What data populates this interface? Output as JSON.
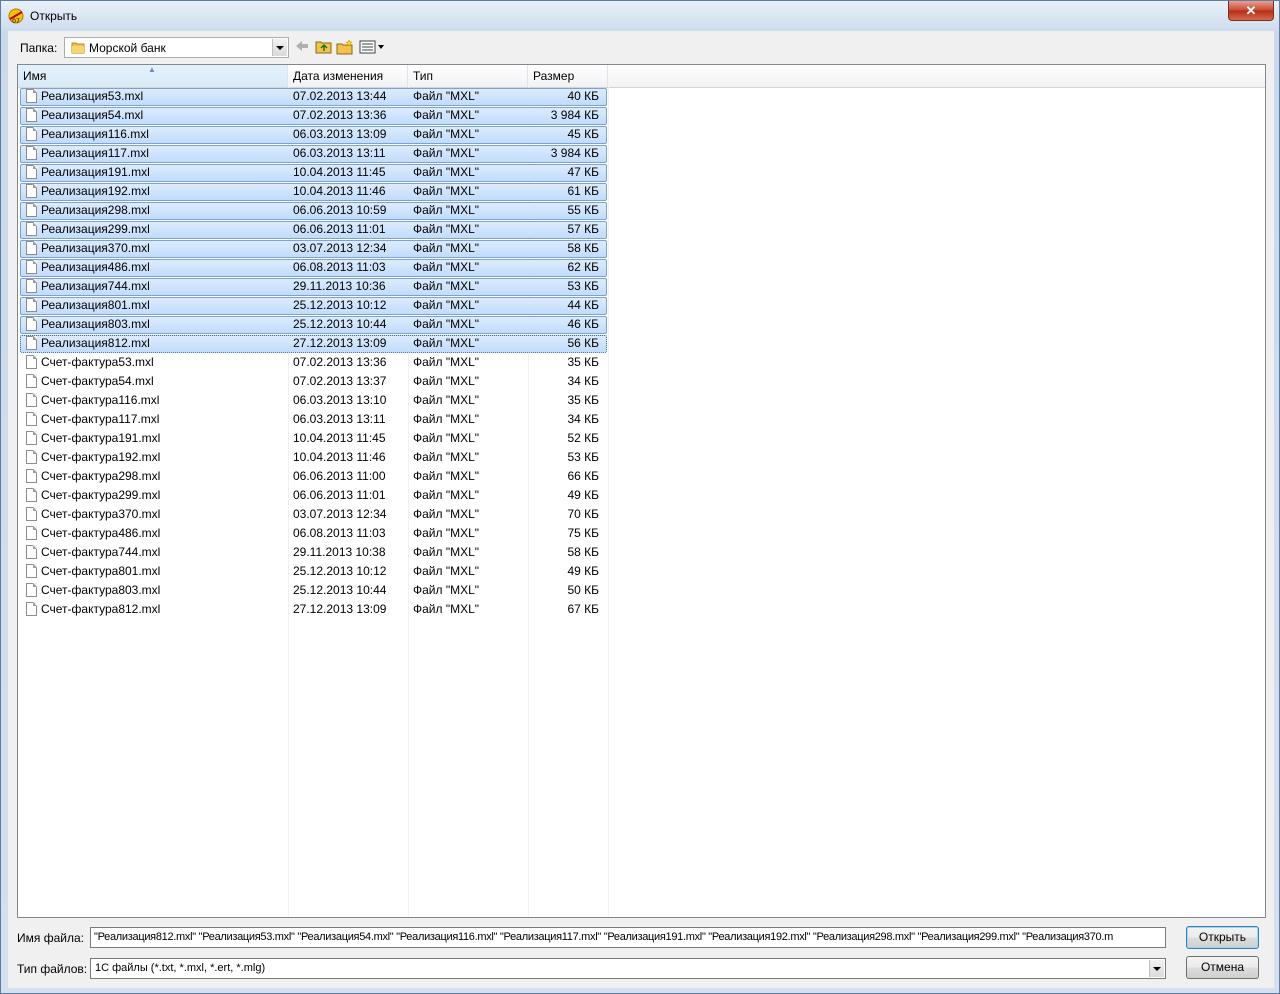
{
  "window": {
    "title": "Открыть",
    "close_label": "✕"
  },
  "toolbar": {
    "folder_label": "Папка:",
    "folder_value": "Морской банк",
    "back_icon": "back-arrow-icon",
    "up_icon": "up-folder-icon",
    "newfolder_icon": "new-folder-icon",
    "view_icon": "view-menu-icon"
  },
  "columns": {
    "name": "Имя",
    "date": "Дата изменения",
    "type": "Тип",
    "size": "Размер"
  },
  "files": [
    {
      "name": "Реализация53.mxl",
      "date": "07.02.2013 13:44",
      "type": "Файл \"MXL\"",
      "size": "40 КБ",
      "selected": true
    },
    {
      "name": "Реализация54.mxl",
      "date": "07.02.2013 13:36",
      "type": "Файл \"MXL\"",
      "size": "3 984 КБ",
      "selected": true
    },
    {
      "name": "Реализация116.mxl",
      "date": "06.03.2013 13:09",
      "type": "Файл \"MXL\"",
      "size": "45 КБ",
      "selected": true
    },
    {
      "name": "Реализация117.mxl",
      "date": "06.03.2013 13:11",
      "type": "Файл \"MXL\"",
      "size": "3 984 КБ",
      "selected": true
    },
    {
      "name": "Реализация191.mxl",
      "date": "10.04.2013 11:45",
      "type": "Файл \"MXL\"",
      "size": "47 КБ",
      "selected": true
    },
    {
      "name": "Реализация192.mxl",
      "date": "10.04.2013 11:46",
      "type": "Файл \"MXL\"",
      "size": "61 КБ",
      "selected": true
    },
    {
      "name": "Реализация298.mxl",
      "date": "06.06.2013 10:59",
      "type": "Файл \"MXL\"",
      "size": "55 КБ",
      "selected": true
    },
    {
      "name": "Реализация299.mxl",
      "date": "06.06.2013 11:01",
      "type": "Файл \"MXL\"",
      "size": "57 КБ",
      "selected": true
    },
    {
      "name": "Реализация370.mxl",
      "date": "03.07.2013 12:34",
      "type": "Файл \"MXL\"",
      "size": "58 КБ",
      "selected": true
    },
    {
      "name": "Реализация486.mxl",
      "date": "06.08.2013 11:03",
      "type": "Файл \"MXL\"",
      "size": "62 КБ",
      "selected": true
    },
    {
      "name": "Реализация744.mxl",
      "date": "29.11.2013 10:36",
      "type": "Файл \"MXL\"",
      "size": "53 КБ",
      "selected": true
    },
    {
      "name": "Реализация801.mxl",
      "date": "25.12.2013 10:12",
      "type": "Файл \"MXL\"",
      "size": "44 КБ",
      "selected": true
    },
    {
      "name": "Реализация803.mxl",
      "date": "25.12.2013 10:44",
      "type": "Файл \"MXL\"",
      "size": "46 КБ",
      "selected": true
    },
    {
      "name": "Реализация812.mxl",
      "date": "27.12.2013 13:09",
      "type": "Файл \"MXL\"",
      "size": "56 КБ",
      "selected": true,
      "focused": true
    },
    {
      "name": "Счет-фактура53.mxl",
      "date": "07.02.2013 13:36",
      "type": "Файл \"MXL\"",
      "size": "35 КБ",
      "selected": false
    },
    {
      "name": "Счет-фактура54.mxl",
      "date": "07.02.2013 13:37",
      "type": "Файл \"MXL\"",
      "size": "34 КБ",
      "selected": false
    },
    {
      "name": "Счет-фактура116.mxl",
      "date": "06.03.2013 13:10",
      "type": "Файл \"MXL\"",
      "size": "35 КБ",
      "selected": false
    },
    {
      "name": "Счет-фактура117.mxl",
      "date": "06.03.2013 13:11",
      "type": "Файл \"MXL\"",
      "size": "34 КБ",
      "selected": false
    },
    {
      "name": "Счет-фактура191.mxl",
      "date": "10.04.2013 11:45",
      "type": "Файл \"MXL\"",
      "size": "52 КБ",
      "selected": false
    },
    {
      "name": "Счет-фактура192.mxl",
      "date": "10.04.2013 11:46",
      "type": "Файл \"MXL\"",
      "size": "53 КБ",
      "selected": false
    },
    {
      "name": "Счет-фактура298.mxl",
      "date": "06.06.2013 11:00",
      "type": "Файл \"MXL\"",
      "size": "66 КБ",
      "selected": false
    },
    {
      "name": "Счет-фактура299.mxl",
      "date": "06.06.2013 11:01",
      "type": "Файл \"MXL\"",
      "size": "49 КБ",
      "selected": false
    },
    {
      "name": "Счет-фактура370.mxl",
      "date": "03.07.2013 12:34",
      "type": "Файл \"MXL\"",
      "size": "70 КБ",
      "selected": false
    },
    {
      "name": "Счет-фактура486.mxl",
      "date": "06.08.2013 11:03",
      "type": "Файл \"MXL\"",
      "size": "75 КБ",
      "selected": false
    },
    {
      "name": "Счет-фактура744.mxl",
      "date": "29.11.2013 10:38",
      "type": "Файл \"MXL\"",
      "size": "58 КБ",
      "selected": false
    },
    {
      "name": "Счет-фактура801.mxl",
      "date": "25.12.2013 10:12",
      "type": "Файл \"MXL\"",
      "size": "49 КБ",
      "selected": false
    },
    {
      "name": "Счет-фактура803.mxl",
      "date": "25.12.2013 10:44",
      "type": "Файл \"MXL\"",
      "size": "50 КБ",
      "selected": false
    },
    {
      "name": "Счет-фактура812.mxl",
      "date": "27.12.2013 13:09",
      "type": "Файл \"MXL\"",
      "size": "67 КБ",
      "selected": false
    }
  ],
  "footer": {
    "filename_label": "Имя файла:",
    "filename_value": "\"Реализация812.mxl\" \"Реализация53.mxl\" \"Реализация54.mxl\" \"Реализация116.mxl\" \"Реализация117.mxl\" \"Реализация191.mxl\" \"Реализация192.mxl\" \"Реализация298.mxl\" \"Реализация299.mxl\" \"Реализация370.m",
    "filetype_label": "Тип файлов:",
    "filetype_value": "1С файлы (*.txt, *.mxl, *.ert, *.mlg)",
    "open_button": "Открыть",
    "cancel_button": "Отмена"
  },
  "colors": {
    "selection": "#c1dcfc",
    "selection_border": "#7da2ce",
    "close": "#c7472f"
  }
}
